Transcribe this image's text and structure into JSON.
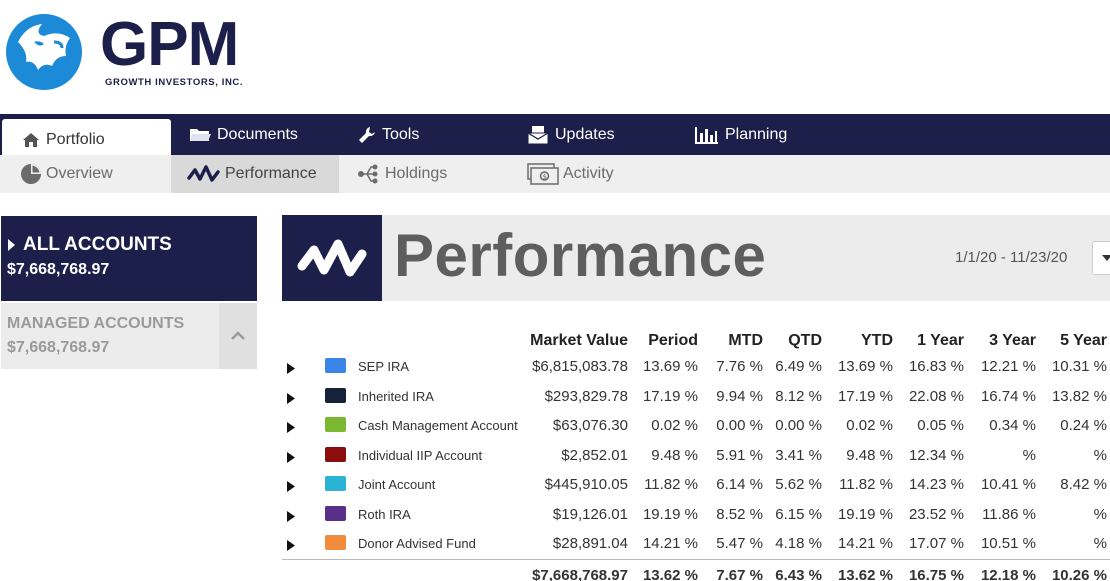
{
  "brand": {
    "name": "GPM",
    "tagline": "GROWTH INVESTORS, INC."
  },
  "nav": {
    "items": [
      {
        "label": "Portfolio",
        "icon": "home-icon",
        "active": true
      },
      {
        "label": "Documents",
        "icon": "folder-icon"
      },
      {
        "label": "Tools",
        "icon": "wrench-icon"
      },
      {
        "label": "Updates",
        "icon": "envelope-icon"
      },
      {
        "label": "Planning",
        "icon": "bar-chart-icon"
      }
    ]
  },
  "subnav": {
    "items": [
      {
        "label": "Overview",
        "icon": "pie-icon"
      },
      {
        "label": "Performance",
        "icon": "pulse-icon",
        "active": true
      },
      {
        "label": "Holdings",
        "icon": "share-icon"
      },
      {
        "label": "Activity",
        "icon": "money-icon"
      }
    ]
  },
  "accounts": {
    "all": {
      "label": "ALL ACCOUNTS",
      "value": "$7,668,768.97"
    },
    "managed": {
      "label": "MANAGED ACCOUNTS",
      "value": "$7,668,768.97"
    }
  },
  "page": {
    "title": "Performance",
    "date_range": "1/1/20 - 11/23/20"
  },
  "table": {
    "headers": [
      "Market Value",
      "Period",
      "MTD",
      "QTD",
      "YTD",
      "1 Year",
      "3 Year",
      "5 Year"
    ],
    "rows": [
      {
        "name": "SEP IRA",
        "color": "#3a86e8",
        "values": [
          "$6,815,083.78",
          "13.69 %",
          "7.76 %",
          "6.49 %",
          "13.69 %",
          "16.83 %",
          "12.21 %",
          "10.31 %"
        ]
      },
      {
        "name": "Inherited IRA",
        "color": "#15223a",
        "values": [
          "$293,829.78",
          "17.19 %",
          "9.94 %",
          "8.12 %",
          "17.19 %",
          "22.08 %",
          "16.74 %",
          "13.82 %"
        ]
      },
      {
        "name": "Cash Management Account",
        "color": "#7cb82f",
        "values": [
          "$63,076.30",
          "0.02 %",
          "0.00 %",
          "0.00 %",
          "0.02 %",
          "0.05 %",
          "0.34 %",
          "0.24 %"
        ]
      },
      {
        "name": "Individual IIP Account",
        "color": "#8b0d0d",
        "values": [
          "$2,852.01",
          "9.48 %",
          "5.91 %",
          "3.41 %",
          "9.48 %",
          "12.34 %",
          "%",
          "%"
        ]
      },
      {
        "name": "Joint Account",
        "color": "#2bb3d6",
        "values": [
          "$445,910.05",
          "11.82 %",
          "6.14 %",
          "5.62 %",
          "11.82 %",
          "14.23 %",
          "10.41 %",
          "8.42 %"
        ]
      },
      {
        "name": "Roth IRA",
        "color": "#5a2f8a",
        "values": [
          "$19,126.01",
          "19.19 %",
          "8.52 %",
          "6.15 %",
          "19.19 %",
          "23.52 %",
          "11.86 %",
          "%"
        ]
      },
      {
        "name": "Donor Advised Fund",
        "color": "#f08c3c",
        "values": [
          "$28,891.04",
          "14.21 %",
          "5.47 %",
          "4.18 %",
          "14.21 %",
          "17.07 %",
          "10.51 %",
          "%"
        ]
      }
    ],
    "total": [
      "$7,668,768.97",
      "13.62 %",
      "7.67 %",
      "6.43 %",
      "13.62 %",
      "16.75 %",
      "12.18 %",
      "10.26 %"
    ]
  }
}
